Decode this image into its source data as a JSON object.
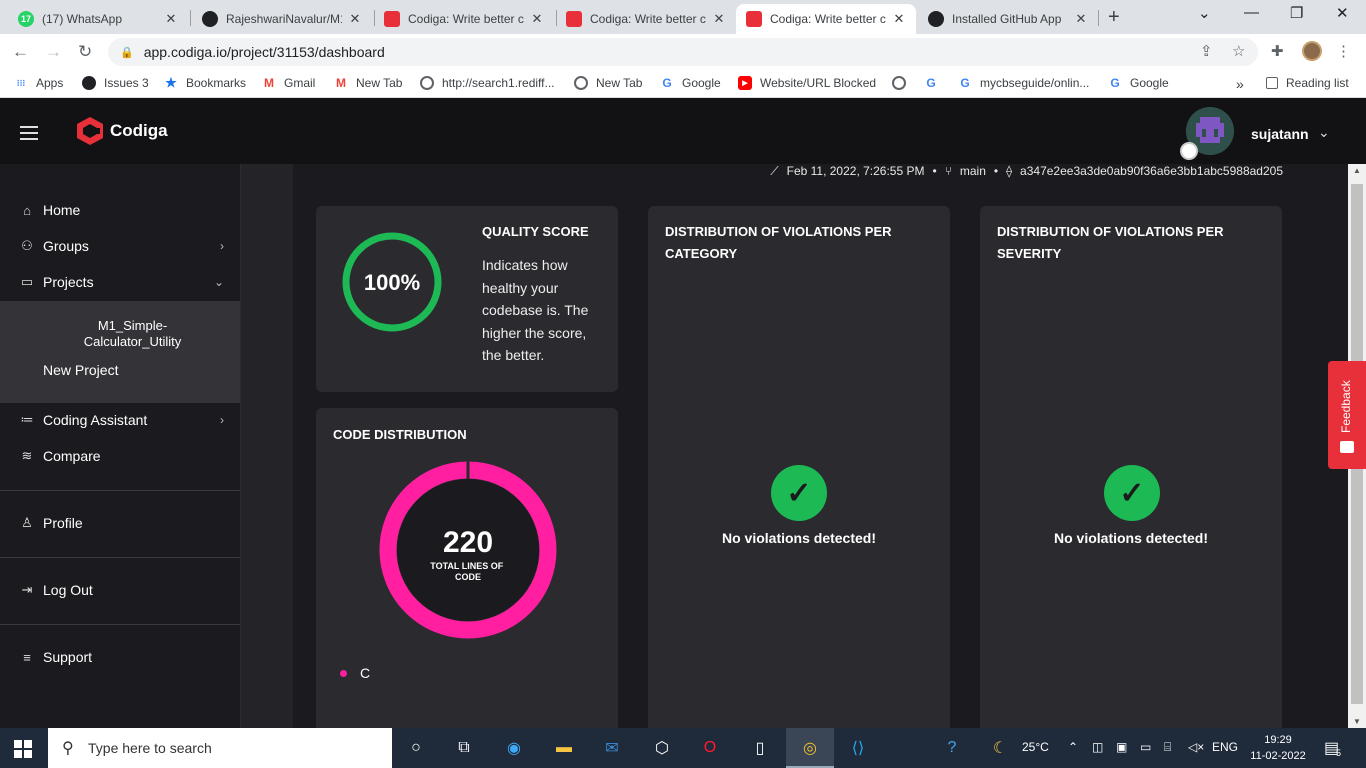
{
  "browser": {
    "tabs": [
      {
        "title": "(17) WhatsApp",
        "icon": "whatsapp-icon",
        "color": "#25d366",
        "badge": "17"
      },
      {
        "title": "RajeshwariNavalur/M1",
        "icon": "github-icon",
        "color": "#202124"
      },
      {
        "title": "Codiga: Write better c",
        "icon": "codiga-icon",
        "color": "#e8303b"
      },
      {
        "title": "Codiga: Write better c",
        "icon": "codiga-icon",
        "color": "#e8303b"
      },
      {
        "title": "Codiga: Write better c",
        "icon": "codiga-icon",
        "color": "#e8303b"
      },
      {
        "title": "Installed GitHub App",
        "icon": "github-icon",
        "color": "#202124"
      }
    ],
    "url": "app.codiga.io/project/31153/dashboard",
    "bookmarks": [
      {
        "label": "Apps",
        "icon": "apps-grid-icon",
        "color": "#4285f4"
      },
      {
        "label": "Issues 3",
        "icon": "github-icon",
        "color": "#202124"
      },
      {
        "label": "Bookmarks",
        "icon": "star-icon",
        "color": "#1a73e8"
      },
      {
        "label": "Gmail",
        "icon": "gmail-icon",
        "color": "#ea4335"
      },
      {
        "label": "New Tab",
        "icon": "gmail-icon",
        "color": "#ea4335"
      },
      {
        "label": "http://search1.rediff...",
        "icon": "globe-icon",
        "color": "#5f6368"
      },
      {
        "label": "New Tab",
        "icon": "globe-icon",
        "color": "#5f6368"
      },
      {
        "label": "Google",
        "icon": "google-icon",
        "color": "#4285f4"
      },
      {
        "label": "Website/URL Blocked",
        "icon": "youtube-icon",
        "color": "#ff0000"
      },
      {
        "label": "",
        "icon": "globe-icon",
        "color": "#5f6368"
      },
      {
        "label": "",
        "icon": "google-icon",
        "color": "#4285f4"
      },
      {
        "label": "mycbseguide/onlin...",
        "icon": "google-icon",
        "color": "#4285f4"
      },
      {
        "label": "Google",
        "icon": "google-icon",
        "color": "#4285f4"
      }
    ],
    "more": "»",
    "reading_list": "Reading list"
  },
  "app": {
    "brand": "Codiga",
    "username": "sujatann"
  },
  "sidebar": {
    "items": [
      {
        "label": "Home",
        "icon": "home-icon"
      },
      {
        "label": "Groups",
        "icon": "groups-icon"
      },
      {
        "label": "Projects",
        "icon": "projects-icon"
      },
      {
        "label": "Coding Assistant",
        "icon": "coding-assistant-icon"
      },
      {
        "label": "Compare",
        "icon": "compare-icon"
      },
      {
        "label": "Profile",
        "icon": "profile-icon"
      },
      {
        "label": "Log Out",
        "icon": "logout-icon"
      },
      {
        "label": "Support",
        "icon": "support-icon"
      }
    ],
    "project_name": "M1_Simple-Calculator_Utility",
    "new_project": "New Project"
  },
  "dashboard": {
    "analysis_date": "Feb 11, 2022, 7:26:55 PM",
    "branch": "main",
    "commit": "a347e2ee3a3de0ab90f36a6e3bb1abc5988ad205",
    "quality_score": {
      "title": "QUALITY SCORE",
      "value": "100%",
      "percent": 100,
      "description": "Indicates how healthy your codebase is. The higher the score, the better.",
      "color": "#1db954"
    },
    "code_distribution": {
      "title": "CODE DISTRIBUTION",
      "total": "220",
      "total_label": "TOTAL LINES OF CODE",
      "color": "#ff1fa0",
      "legend": [
        {
          "label": "C",
          "lines": 220
        }
      ]
    },
    "violations_category": {
      "title": "DISTRIBUTION OF VIOLATIONS PER CATEGORY",
      "message": "No violations detected!"
    },
    "violations_severity": {
      "title": "DISTRIBUTION OF VIOLATIONS PER SEVERITY",
      "message": "No violations detected!"
    },
    "feedback": "Feedback"
  },
  "taskbar": {
    "search_placeholder": "Type here to search",
    "temperature": "25°C",
    "language": "ENG",
    "time": "19:29",
    "date": "11-02-2022",
    "notifications": "5"
  }
}
